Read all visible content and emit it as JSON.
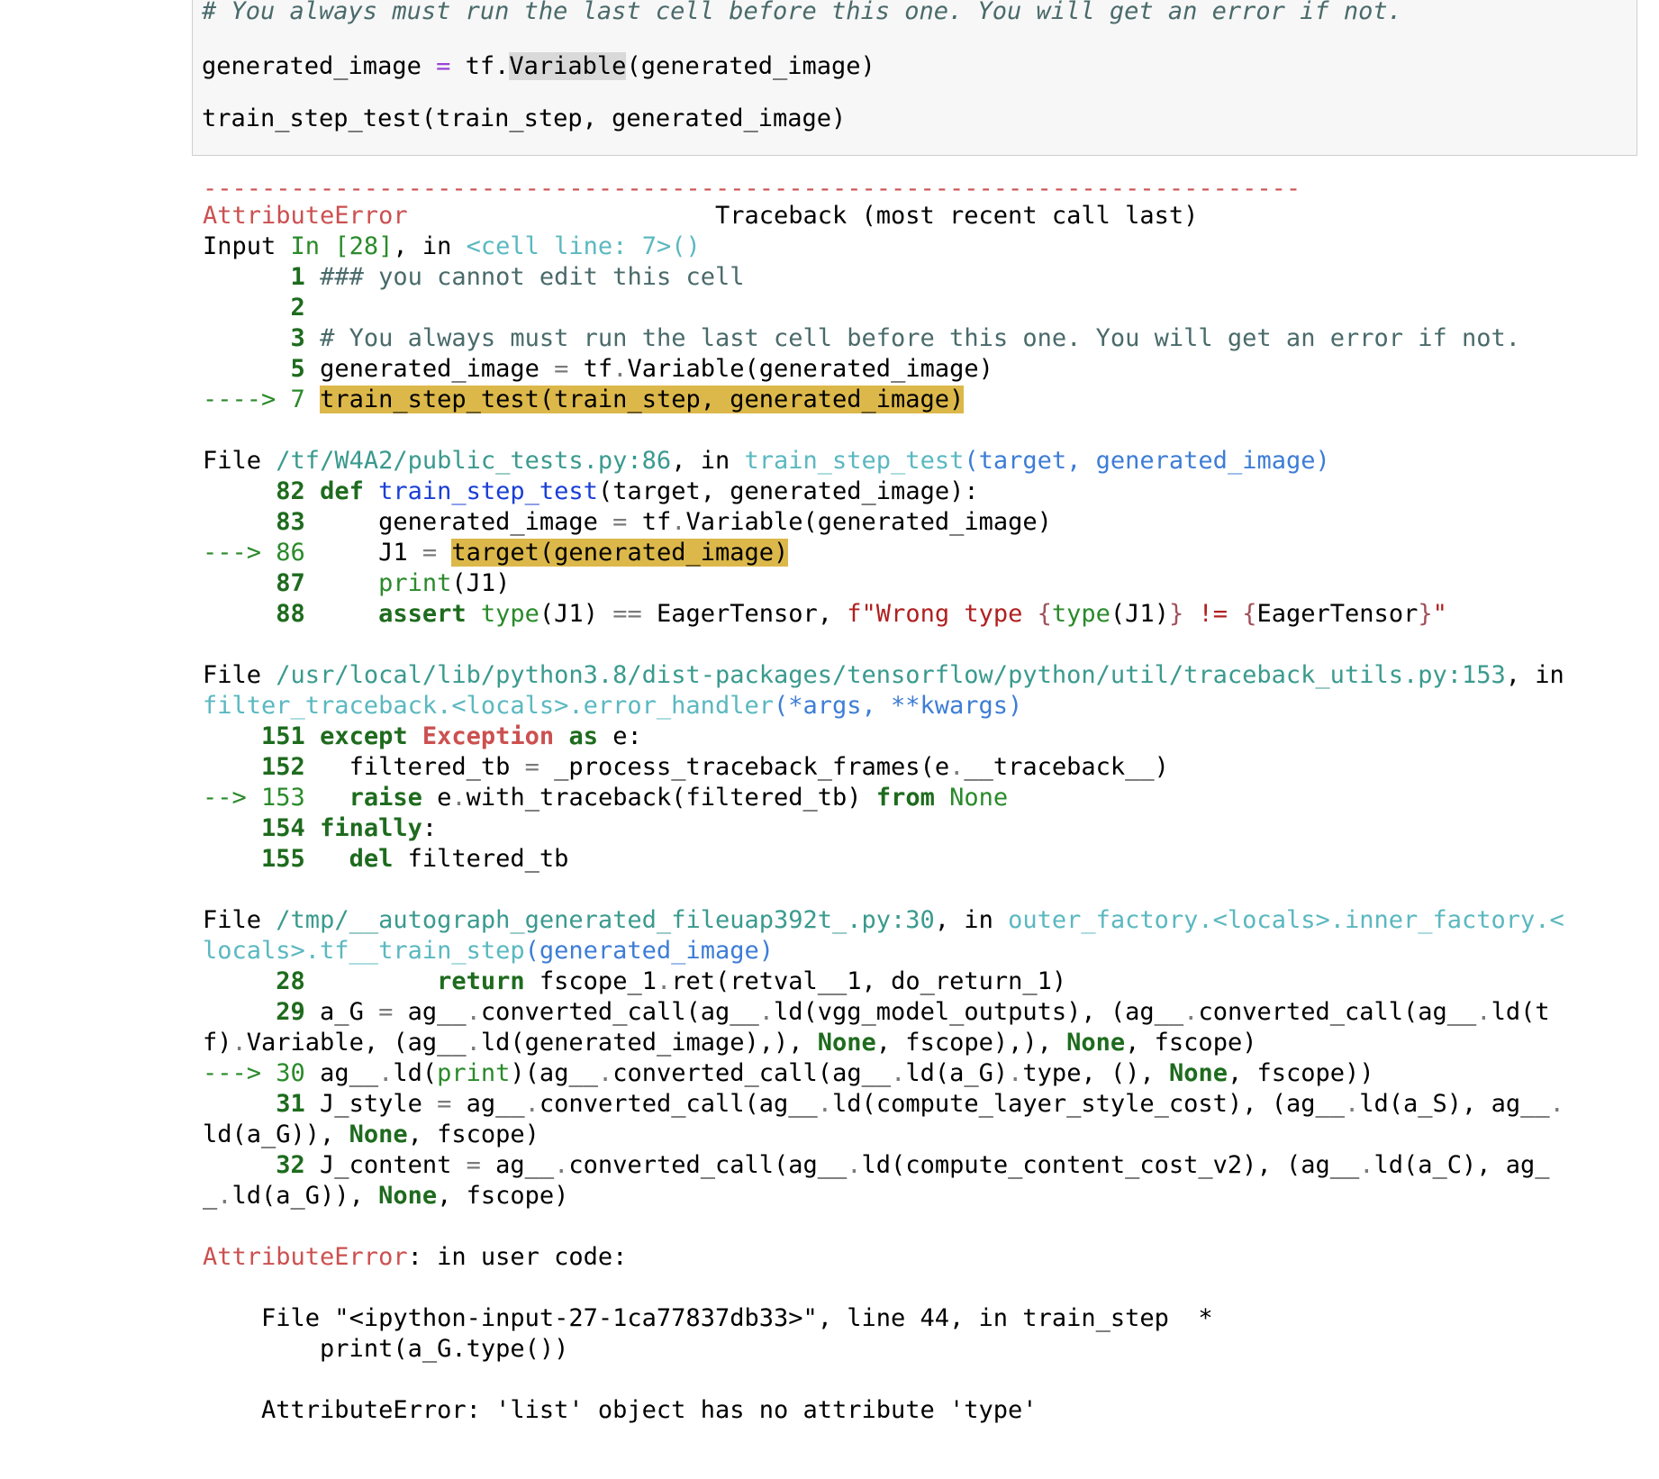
{
  "input_cell": {
    "lines": [
      "# You always must run the last cell before this one. You will get an error if not.",
      "generated_image = tf.Variable(generated_image)",
      "train_step_test(train_step, generated_image)"
    ]
  },
  "traceback": {
    "separator": "---------------------------------------------------------------------------",
    "error_name": "AttributeError",
    "header_right": "Traceback (most recent call last)",
    "input_label": "Input",
    "input_ref": "In [28]",
    "input_loc": "<cell line: 7>()",
    "input_lines": [
      {
        "num": "1",
        "text": "### you cannot edit this cell"
      },
      {
        "num": "2",
        "text": ""
      },
      {
        "num": "3",
        "text": "# You always must run the last cell before this one. You will get an error if not."
      },
      {
        "num": "5",
        "text": "generated_image = tf.Variable(generated_image)"
      },
      {
        "arrow": "---->",
        "num": "7",
        "text": "train_step_test(train_step, generated_image)"
      }
    ],
    "frame1": {
      "path": "/tf/W4A2/public_tests.py:86",
      "func": "train_step_test(target, generated_image)",
      "lines": [
        "82",
        "83",
        "86",
        "87",
        "88"
      ],
      "arrow": "--->"
    },
    "frame2": {
      "path": "/usr/local/lib/python3.8/dist-packages/tensorflow/python/util/traceback_utils.py:153",
      "func": "filter_traceback.<locals>.error_handler(*args, **kwargs)",
      "lines": [
        "151",
        "152",
        "153",
        "154",
        "155"
      ],
      "arrow": "-->"
    },
    "frame3": {
      "path": "/tmp/__autograph_generated_fileuap392t_.py:30",
      "func_a": "outer_factory.<locals>.inner_factory.<",
      "func_b": "locals>.tf__train_step(generated_image)",
      "lines": [
        "28",
        "29",
        "30",
        "31",
        "32"
      ],
      "arrow": "--->"
    },
    "final": {
      "error_name": "AttributeError",
      "suffix": ": in user code:",
      "file_line": "File \"<ipython-input-27-1ca77837db33>\", line 44, in train_step  *",
      "code_line": "print(a_G.type())",
      "message": "AttributeError: 'list' object has no attribute 'type'"
    }
  },
  "words": {
    "file": "File",
    "in": "in",
    "comma_in": ", in",
    "def": "def",
    "assert": "assert",
    "except": "except",
    "exception": "Exception",
    "as": "as",
    "raise": "raise",
    "from": "from",
    "none": "None",
    "finally": "finally",
    "del": "del",
    "return": "return",
    "print": "print",
    "type": "type"
  }
}
